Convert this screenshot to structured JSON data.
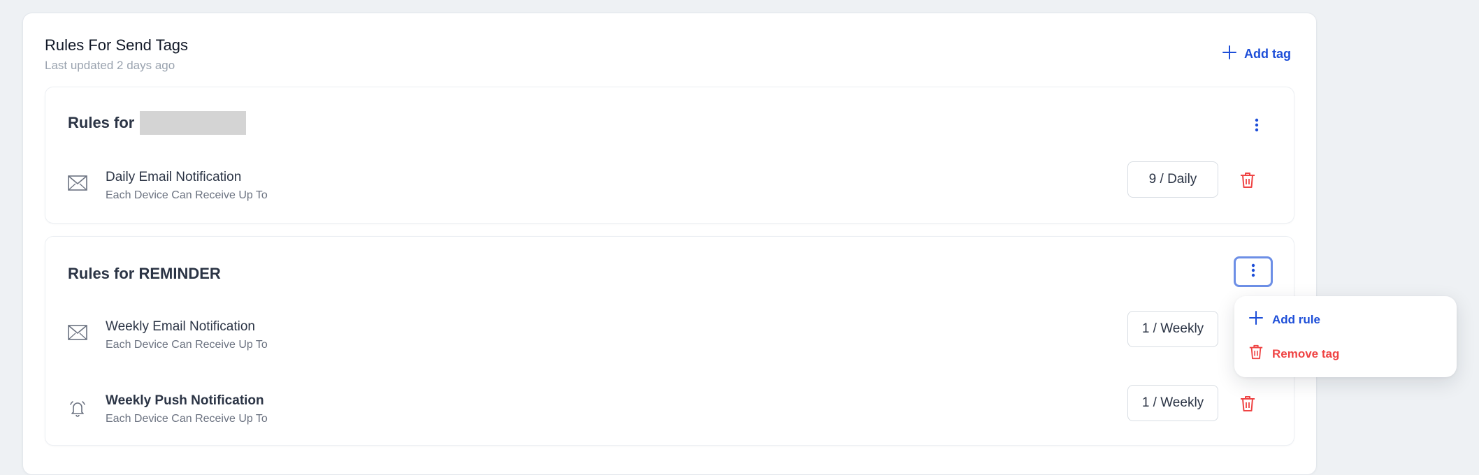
{
  "header": {
    "title": "Rules For Send Tags",
    "subtitle": "Last updated 2 days ago",
    "add_tag_label": "Add tag"
  },
  "groups": [
    {
      "title_prefix": "Rules for",
      "tag_name_redacted": true,
      "rules": [
        {
          "icon": "envelope-icon",
          "name": "Daily Email Notification",
          "description": "Each Device Can Receive Up To",
          "limit": "9 / Daily"
        }
      ]
    },
    {
      "title": "Rules for REMINDER",
      "rules": [
        {
          "icon": "envelope-icon",
          "name": "Weekly Email Notification",
          "description": "Each Device Can Receive Up To",
          "limit": "1 / Weekly"
        },
        {
          "icon": "bell-icon",
          "name": "Weekly Push Notification",
          "description": "Each Device Can Receive Up To",
          "limit": "1 / Weekly"
        }
      ]
    }
  ],
  "dropdown_menu": {
    "items": [
      {
        "label": "Add rule",
        "icon": "plus-icon",
        "color": "#1d4ed8"
      },
      {
        "label": "Remove tag",
        "icon": "trash-icon",
        "color": "#ef4444"
      }
    ]
  },
  "colors": {
    "accent": "#1d4ed8",
    "danger": "#ef4444",
    "background": "#eef1f4"
  }
}
